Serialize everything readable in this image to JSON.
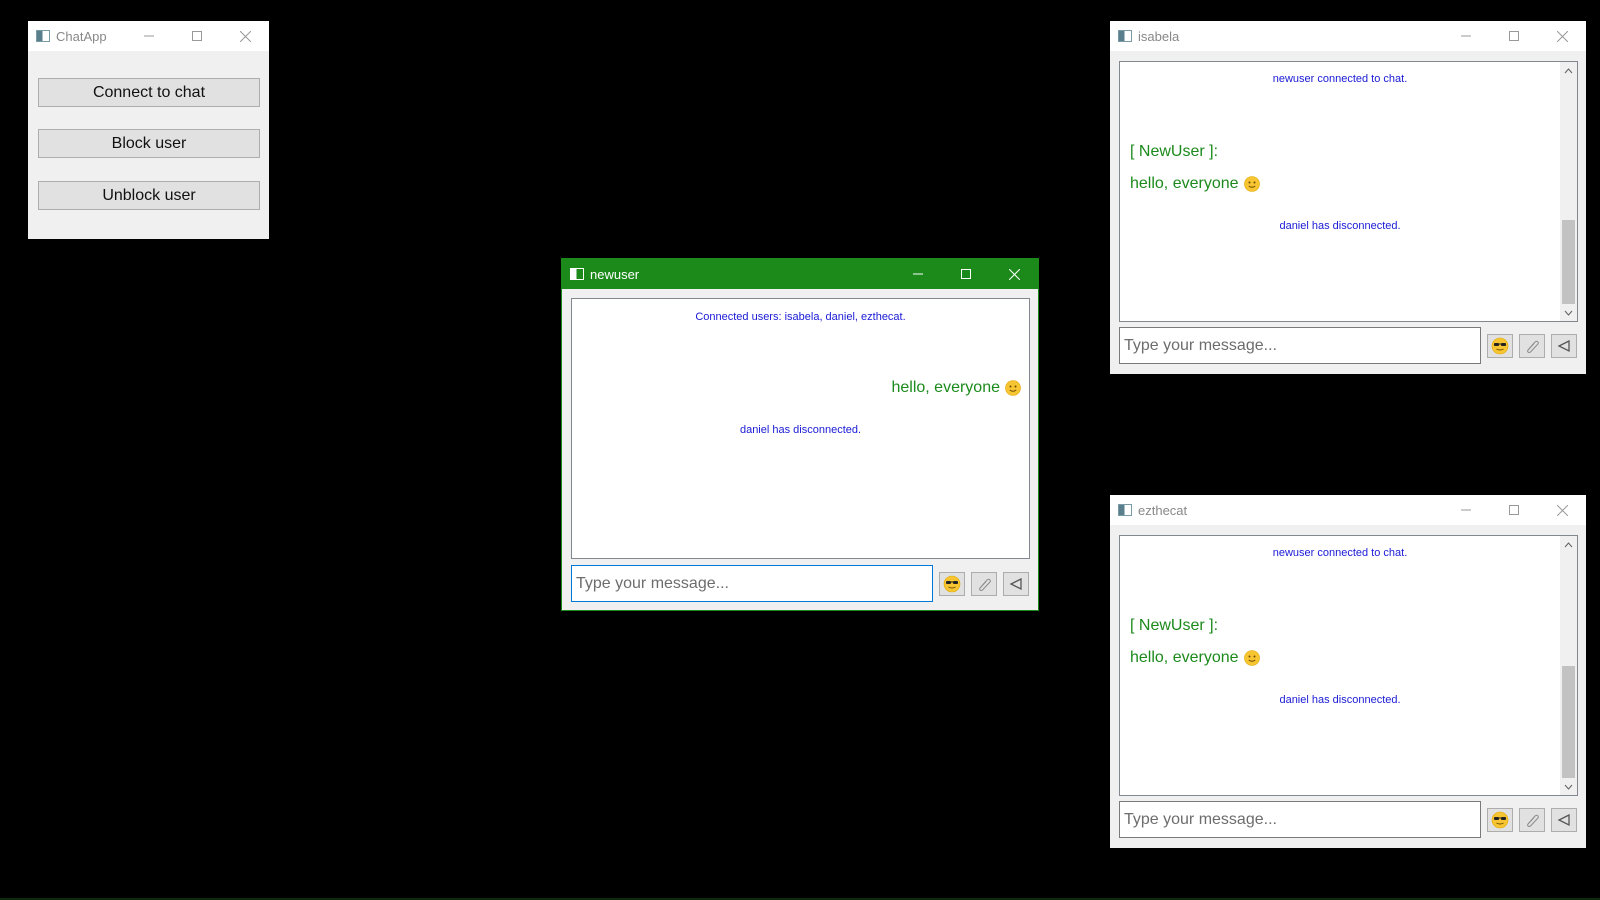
{
  "launcher": {
    "title": "ChatApp",
    "buttons": [
      "Connect to chat",
      "Block user",
      "Unblock user"
    ]
  },
  "newuser_window": {
    "title": "newuser",
    "messages": {
      "connected_users": "Connected users: isabela, daniel, ezthecat.",
      "own_message": "hello, everyone",
      "disconnect": "daniel has disconnected."
    },
    "input_placeholder": "Type your message..."
  },
  "isabela_window": {
    "title": "isabela",
    "messages": {
      "connected": "newuser connected to chat.",
      "sender": "[ NewUser ]:",
      "text": "hello, everyone",
      "disconnect": "daniel has disconnected."
    },
    "input_placeholder": "Type your message..."
  },
  "ezthecat_window": {
    "title": "ezthecat",
    "messages": {
      "connected": "newuser connected to chat.",
      "sender": "[ NewUser ]:",
      "text": "hello, everyone",
      "disconnect": "daniel has disconnected."
    },
    "input_placeholder": "Type your message..."
  },
  "icons": {
    "emoji_button": "sunglasses-emoji-icon",
    "attach_button": "paperclip-icon",
    "send_button": "send-arrow-icon",
    "message_emoji": "smiley-icon"
  },
  "colors": {
    "active_titlebar": "#1b8a1b",
    "system_message": "#1a1ad6",
    "user_message": "#1c8a1c"
  }
}
